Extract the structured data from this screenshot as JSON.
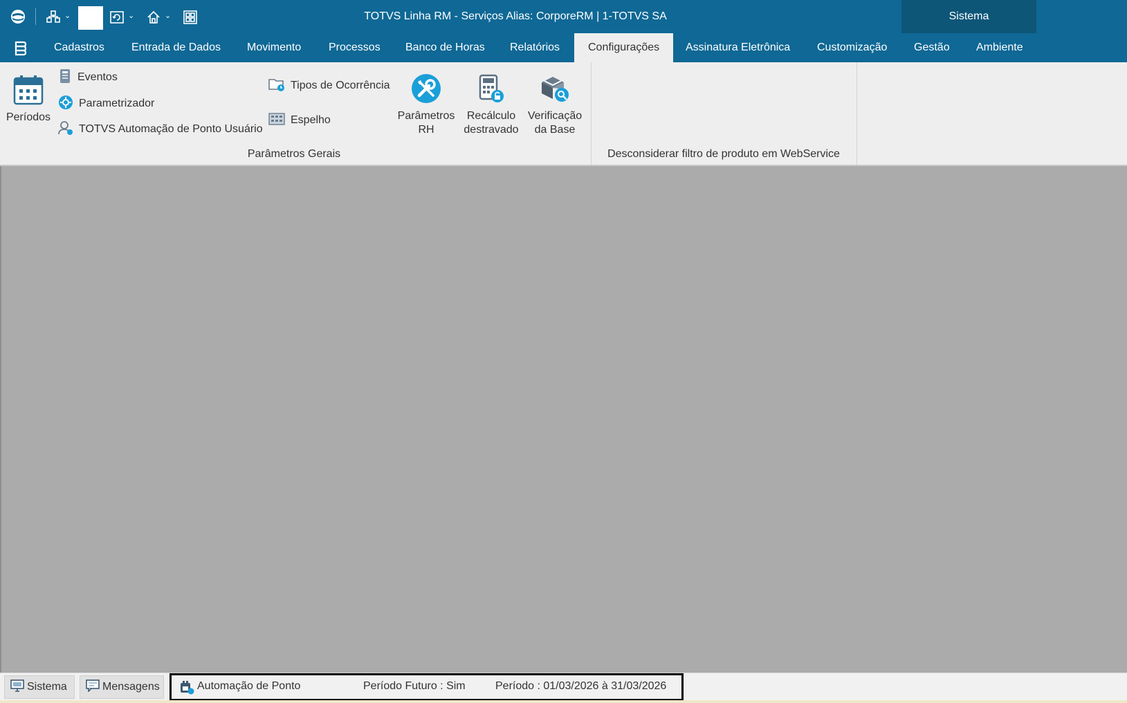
{
  "window": {
    "title": "TOTVS Linha RM - Serviços  Alias: CorporeRM | 1-TOTVS SA",
    "right_panel_label": "Sistema"
  },
  "quick_access": {
    "icons": [
      "app-logo-icon",
      "users-icon",
      "refresh-icon",
      "home-icon",
      "layout-grid-icon"
    ]
  },
  "menu": {
    "items": [
      {
        "label": "Cadastros"
      },
      {
        "label": "Entrada de Dados"
      },
      {
        "label": "Movimento"
      },
      {
        "label": "Processos"
      },
      {
        "label": "Banco de Horas"
      },
      {
        "label": "Relatórios"
      },
      {
        "label": "Configurações",
        "active": true
      },
      {
        "label": "Assinatura Eletrônica"
      },
      {
        "label": "Customização"
      },
      {
        "label": "Gestão"
      },
      {
        "label": "Ambiente"
      }
    ]
  },
  "ribbon": {
    "groups": [
      {
        "label": "Parâmetros Gerais",
        "large_buttons": [
          {
            "label": "Períodos",
            "icon": "calendar-icon"
          },
          {
            "label_line1": "Parâmetros",
            "label_line2": "RH",
            "icon": "tools-icon"
          },
          {
            "label_line1": "Recálculo",
            "label_line2": "destravado",
            "icon": "calculator-icon"
          },
          {
            "label_line1": "Verificação",
            "label_line2": "da Base",
            "icon": "database-search-icon"
          }
        ],
        "small_buttons": [
          {
            "label": "Eventos",
            "icon": "events-icon"
          },
          {
            "label": "Parametrizador",
            "icon": "settings-icon"
          },
          {
            "label": "TOTVS Automação de Ponto Usuário",
            "icon": "user-settings-icon"
          },
          {
            "label": "Tipos de Ocorrência",
            "icon": "occurrence-folder-icon"
          },
          {
            "label": "Espelho",
            "icon": "mirror-icon"
          }
        ]
      },
      {
        "label": "Desconsiderar filtro de produto em WebService"
      }
    ]
  },
  "statusbar": {
    "sistema_label": "Sistema",
    "mensagens_label": "Mensagens",
    "module_label": "Automação de Ponto",
    "periodo_futuro": "Período Futuro : Sim",
    "periodo": "Período : 01/03/2026 à 31/03/2026"
  },
  "colors": {
    "titlebar": "#0f6895",
    "titlebar_dark": "#0d5678",
    "ribbon_bg": "#eeeeee",
    "workspace_bg": "#ababab",
    "accent_icon": "#1a9fd9"
  }
}
